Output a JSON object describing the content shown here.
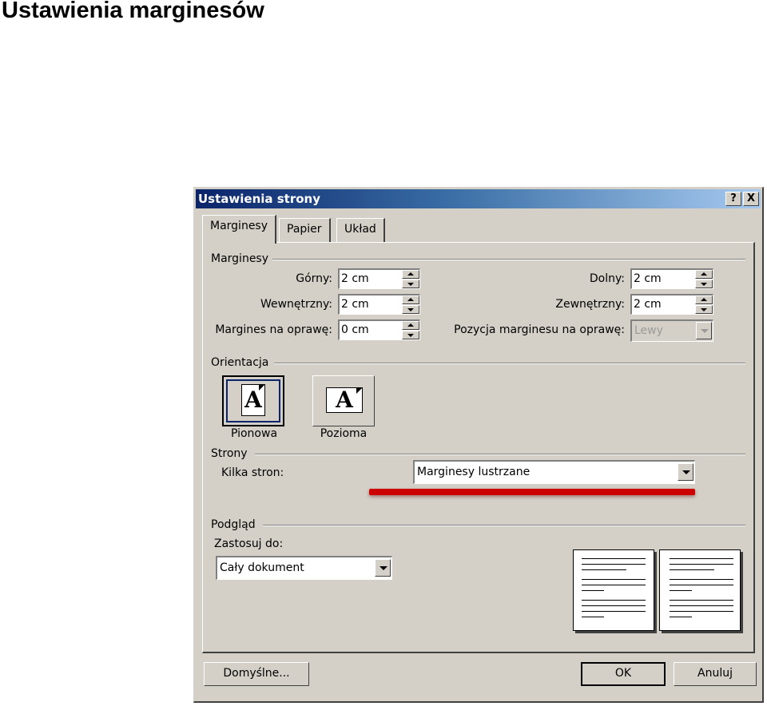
{
  "slide_title": "Ustawienia marginesów",
  "dialog": {
    "title": "Ustawienia strony",
    "help_button": "?",
    "close_button": "X",
    "tabs": [
      {
        "label": "Marginesy",
        "active": true
      },
      {
        "label": "Papier",
        "active": false
      },
      {
        "label": "Układ",
        "active": false
      }
    ],
    "margins": {
      "group": "Marginesy",
      "top_label": "Górny:",
      "top_value": "2 cm",
      "bottom_label": "Dolny:",
      "bottom_value": "2 cm",
      "inner_label": "Wewnętrzny:",
      "inner_value": "2 cm",
      "outer_label": "Zewnętrzny:",
      "outer_value": "2 cm",
      "gutter_label": "Margines na oprawę:",
      "gutter_value": "0 cm",
      "gutter_pos_label": "Pozycja marginesu na oprawę:",
      "gutter_pos_value": "Lewy"
    },
    "orientation": {
      "group": "Orientacja",
      "portrait": "Pionowa",
      "landscape": "Pozioma",
      "icon_letter": "A",
      "selected": "portrait"
    },
    "pages": {
      "group": "Strony",
      "multiple_label": "Kilka stron:",
      "multiple_value": "Marginesy lustrzane"
    },
    "preview": {
      "group": "Podgląd",
      "apply_label": "Zastosuj do:",
      "apply_value": "Cały dokument"
    },
    "buttons": {
      "default": "Domyślne...",
      "ok": "OK",
      "cancel": "Anuluj"
    }
  },
  "colors": {
    "dialog_bg": "#d4d0c8",
    "titlebar_start": "#0a246a",
    "titlebar_end": "#a6caf0",
    "highlight_red": "#cc0000"
  }
}
